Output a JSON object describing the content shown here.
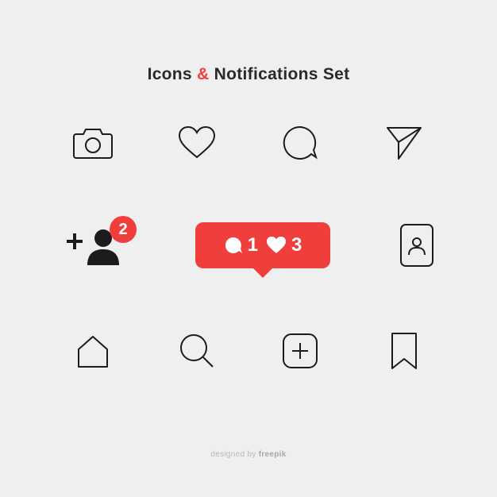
{
  "title": {
    "pre": "Icons ",
    "amp": "&",
    "post": " Notifications Set"
  },
  "colors": {
    "accent": "#ef3e3b",
    "stroke": "#1c1c1c",
    "bg": "#efefef"
  },
  "icons_row1": [
    "camera",
    "heart",
    "comment",
    "send"
  ],
  "notifications": {
    "follower_badge": "2",
    "bubble": {
      "comments": "1",
      "likes": "3"
    }
  },
  "icons_row3": [
    "home",
    "search",
    "add-post",
    "bookmark"
  ],
  "profile_icon": "profile",
  "credit": {
    "prefix": "designed by ",
    "brand": "freepik"
  }
}
